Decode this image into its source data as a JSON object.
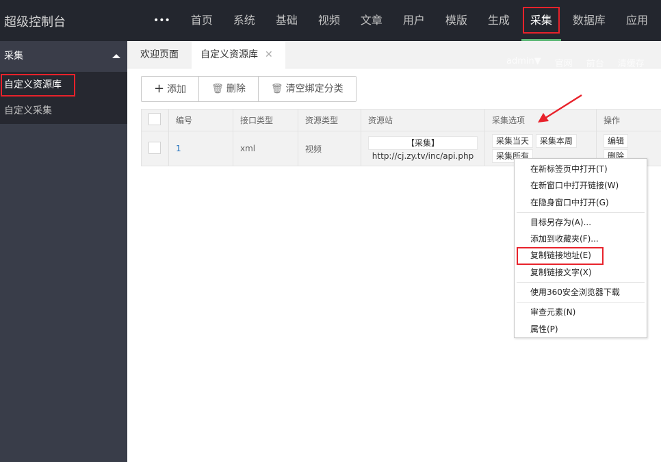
{
  "header": {
    "title": "超级控制台",
    "more": "•••",
    "nav": [
      "首页",
      "系统",
      "基础",
      "视频",
      "文章",
      "用户",
      "模版",
      "生成",
      "采集",
      "数据库",
      "应用"
    ],
    "active": "采集"
  },
  "sidebar": {
    "section": "采集",
    "items": [
      "自定义资源库",
      "自定义采集"
    ]
  },
  "tabs": [
    "欢迎页面",
    "自定义资源库"
  ],
  "userbar": [
    "admin▼",
    "官网",
    "前台",
    "清缓存"
  ],
  "toolbar": {
    "add": "添加",
    "delete": "删除",
    "clear": "清空绑定分类"
  },
  "table": {
    "headers": [
      "编号",
      "接口类型",
      "资源类型",
      "资源站",
      "采集选项",
      "操作"
    ],
    "rows": [
      {
        "id": "1",
        "api_type": "xml",
        "res_type": "视频",
        "site_link": "【采集】",
        "site_url": "http://cj.zy.tv/inc/api.php",
        "options": [
          "采集当天",
          "采集本周",
          "采集所有"
        ],
        "actions": [
          "编辑",
          "删除"
        ]
      }
    ]
  },
  "context_menu": {
    "groups": [
      [
        "在新标签页中打开(T)",
        "在新窗口中打开链接(W)",
        "在隐身窗口中打开(G)"
      ],
      [
        "目标另存为(A)...",
        "添加到收藏夹(F)...",
        "复制链接地址(E)",
        "复制链接文字(X)"
      ],
      [
        "使用360安全浏览器下载"
      ],
      [
        "审查元素(N)",
        "属性(P)"
      ]
    ]
  },
  "colors": {
    "topbar": "#23262e",
    "sidebar": "#393d49",
    "highlight": "#e8222b",
    "active_bar": "#5fb878"
  }
}
